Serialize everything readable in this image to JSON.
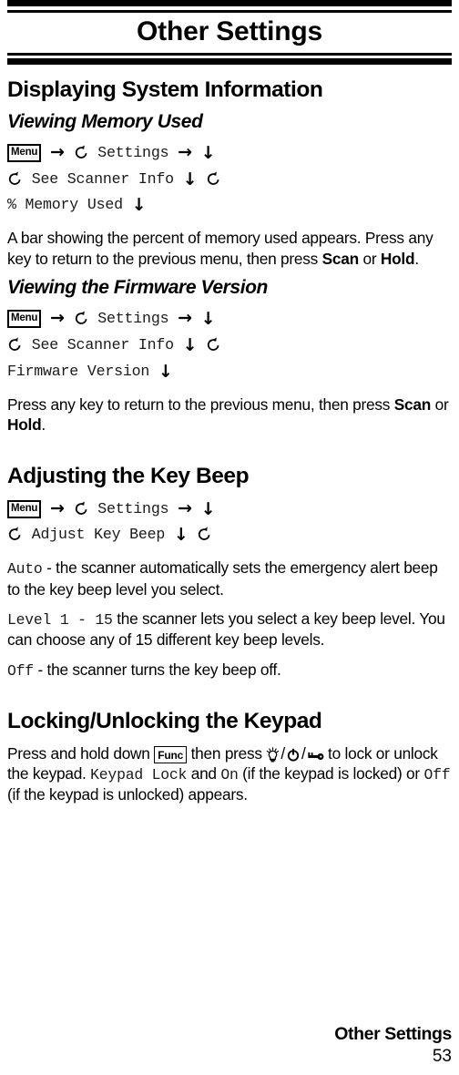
{
  "header": {
    "title": "Other Settings"
  },
  "sections": [
    {
      "heading": "Displaying System Information",
      "subheading": "Viewing Memory Used",
      "nav": {
        "key": "Menu",
        "line1_item": "Settings",
        "line2_item": "See Scanner Info",
        "line3_item": "% Memory Used"
      },
      "body_1": "A bar showing the percent of memory used appears. Press any key to return to the previous menu, then press ",
      "body_1_b1": "Scan",
      "body_1_mid": " or ",
      "body_1_b2": "Hold",
      "body_1_end": "."
    },
    {
      "subheading": "Viewing the Firmware Version",
      "nav": {
        "key": "Menu",
        "line1_item": "Settings",
        "line2_item": "See Scanner Info",
        "line3_item": "Firmware Version"
      },
      "body_1": "Press any key to return to the previous menu, then press ",
      "body_1_b1": "Scan",
      "body_1_mid": " or ",
      "body_1_b2": "Hold",
      "body_1_end": "."
    }
  ],
  "keybeep": {
    "heading": "Adjusting the Key Beep",
    "nav": {
      "key": "Menu",
      "line1_item": "Settings",
      "line2_item": "Adjust Key Beep"
    },
    "options": [
      {
        "name": "Auto",
        "dash": " - ",
        "desc": "the scanner automatically sets the emergency alert beep to the key beep level you select."
      },
      {
        "name": "Level 1 - 15",
        "dash": "  ",
        "desc": "the scanner lets you select a key beep level. You can choose any of 15 different key beep levels."
      },
      {
        "name": "Off",
        "dash": " - ",
        "desc": "the scanner turns the key beep off."
      }
    ]
  },
  "keypad": {
    "heading": "Locking/Unlocking the Keypad",
    "text_1": "Press and hold down ",
    "func_key": "Func",
    "text_2": " then press ",
    "icons": [
      "light-bulb-icon",
      "power-icon",
      "key-icon"
    ],
    "text_3": "  to lock or unlock the keypad. ",
    "mono_1": "Keypad Lock",
    "text_4": " and ",
    "mono_2": "On",
    "text_5": " (if the keypad is locked) or ",
    "mono_3": "Off",
    "text_6": "  (if the keypad is unlocked) appears."
  },
  "footer": {
    "title": "Other Settings",
    "page": "53"
  },
  "icons": {
    "arrow_right": "→",
    "arrow_down": "↓",
    "circular_arrow": "circular-arrow-icon",
    "slash": "/"
  }
}
